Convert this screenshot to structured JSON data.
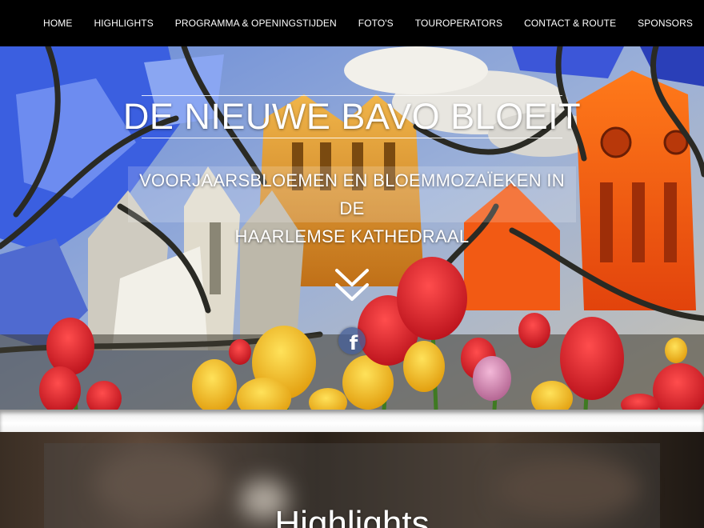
{
  "nav": {
    "items": [
      {
        "label": "HOME",
        "name": "nav-home"
      },
      {
        "label": "HIGHLIGHTS",
        "name": "nav-highlights"
      },
      {
        "label": "PROGRAMMA & OPENINGSTIJDEN",
        "name": "nav-programma"
      },
      {
        "label": "FOTO'S",
        "name": "nav-fotos"
      },
      {
        "label": "TOUROPERATORS",
        "name": "nav-touroperators"
      },
      {
        "label": "CONTACT & ROUTE",
        "name": "nav-contact"
      },
      {
        "label": "SPONSORS",
        "name": "nav-sponsors"
      }
    ]
  },
  "hero": {
    "title": "DE NIEUWE BAVO BLOEIT",
    "subtitle_line1": "VOORJAARSBLOEMEN EN BLOEMMOZAÏEKEN IN DE",
    "subtitle_line2": "HAARLEMSE KATHEDRAAL",
    "scroll_icon": "double-chevron-down-icon",
    "social": {
      "icon": "facebook-icon",
      "glyph": "f"
    }
  },
  "highlights": {
    "heading": "Highlights"
  },
  "colors": {
    "navbar": "#000000",
    "text": "#ffffff",
    "facebook": "#465f96"
  }
}
